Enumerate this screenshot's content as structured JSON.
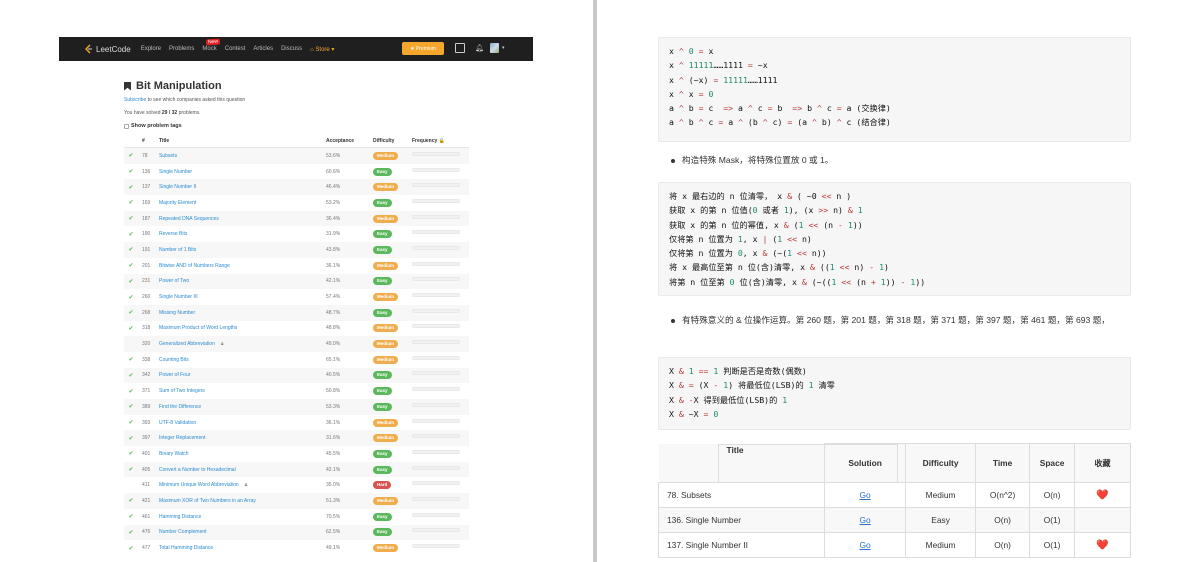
{
  "left": {
    "navbar": {
      "brand": "LeetCode",
      "items": [
        "Explore",
        "Problems",
        "Mock",
        "Contest",
        "Articles",
        "Discuss"
      ],
      "new_badge": "New",
      "store": "Store ▾",
      "premium": "★ Premium"
    },
    "page_title": "Bit Manipulation",
    "subscribe_link": "Subscribe",
    "subscribe_text": " to see which companies asked this question",
    "solved_prefix": "You have solved ",
    "solved_count": "29 / 32",
    "solved_suffix": " problems.",
    "show_tags": "Show problem tags",
    "columns": [
      "#",
      "Title",
      "Acceptance",
      "Difficulty",
      "Frequency 🔒"
    ],
    "rows": [
      {
        "solved": true,
        "num": "78",
        "title": "Subsets",
        "acc": "53.6%",
        "diff": "Medium",
        "locked": false
      },
      {
        "solved": true,
        "num": "136",
        "title": "Single Number",
        "acc": "60.6%",
        "diff": "Easy",
        "locked": false
      },
      {
        "solved": true,
        "num": "137",
        "title": "Single Number II",
        "acc": "46.4%",
        "diff": "Medium",
        "locked": false
      },
      {
        "solved": true,
        "num": "169",
        "title": "Majority Element",
        "acc": "53.2%",
        "diff": "Easy",
        "locked": false
      },
      {
        "solved": true,
        "num": "187",
        "title": "Repeated DNA Sequences",
        "acc": "36.4%",
        "diff": "Medium",
        "locked": false
      },
      {
        "solved": true,
        "num": "190",
        "title": "Reverse Bits",
        "acc": "31.9%",
        "diff": "Easy",
        "locked": false
      },
      {
        "solved": true,
        "num": "191",
        "title": "Number of 1 Bits",
        "acc": "43.8%",
        "diff": "Easy",
        "locked": false
      },
      {
        "solved": true,
        "num": "201",
        "title": "Bitwise AND of Numbers Range",
        "acc": "36.1%",
        "diff": "Medium",
        "locked": false
      },
      {
        "solved": true,
        "num": "231",
        "title": "Power of Two",
        "acc": "42.1%",
        "diff": "Easy",
        "locked": false
      },
      {
        "solved": true,
        "num": "260",
        "title": "Single Number III",
        "acc": "57.4%",
        "diff": "Medium",
        "locked": false
      },
      {
        "solved": true,
        "num": "268",
        "title": "Missing Number",
        "acc": "48.7%",
        "diff": "Easy",
        "locked": false
      },
      {
        "solved": true,
        "num": "318",
        "title": "Maximum Product of Word Lengths",
        "acc": "48.8%",
        "diff": "Medium",
        "locked": false
      },
      {
        "solved": false,
        "num": "320",
        "title": "Generalized Abbreviation",
        "acc": "49.0%",
        "diff": "Medium",
        "locked": true
      },
      {
        "solved": true,
        "num": "338",
        "title": "Counting Bits",
        "acc": "65.1%",
        "diff": "Medium",
        "locked": false
      },
      {
        "solved": true,
        "num": "342",
        "title": "Power of Four",
        "acc": "40.5%",
        "diff": "Easy",
        "locked": false
      },
      {
        "solved": true,
        "num": "371",
        "title": "Sum of Two Integers",
        "acc": "50.8%",
        "diff": "Easy",
        "locked": false
      },
      {
        "solved": true,
        "num": "389",
        "title": "Find the Difference",
        "acc": "53.3%",
        "diff": "Easy",
        "locked": false
      },
      {
        "solved": true,
        "num": "393",
        "title": "UTF-8 Validation",
        "acc": "36.1%",
        "diff": "Medium",
        "locked": false
      },
      {
        "solved": true,
        "num": "397",
        "title": "Integer Replacement",
        "acc": "31.6%",
        "diff": "Medium",
        "locked": false
      },
      {
        "solved": true,
        "num": "401",
        "title": "Binary Watch",
        "acc": "45.5%",
        "diff": "Easy",
        "locked": false
      },
      {
        "solved": true,
        "num": "405",
        "title": "Convert a Number to Hexadecimal",
        "acc": "42.1%",
        "diff": "Easy",
        "locked": false
      },
      {
        "solved": false,
        "num": "411",
        "title": "Minimum Unique Word Abbreviation",
        "acc": "35.0%",
        "diff": "Hard",
        "locked": true
      },
      {
        "solved": true,
        "num": "421",
        "title": "Maximum XOR of Two Numbers in an Array",
        "acc": "51.3%",
        "diff": "Medium",
        "locked": false
      },
      {
        "solved": true,
        "num": "461",
        "title": "Hamming Distance",
        "acc": "70.5%",
        "diff": "Easy",
        "locked": false
      },
      {
        "solved": true,
        "num": "476",
        "title": "Number Complement",
        "acc": "62.5%",
        "diff": "Easy",
        "locked": false
      },
      {
        "solved": true,
        "num": "477",
        "title": "Total Hamming Distance",
        "acc": "49.1%",
        "diff": "Medium",
        "locked": false
      }
    ]
  },
  "right": {
    "code1": [
      [
        [
          "t",
          "x "
        ],
        [
          "k",
          "^"
        ],
        [
          "t",
          " "
        ],
        [
          "n",
          "0"
        ],
        [
          "t",
          " "
        ],
        [
          "k",
          "="
        ],
        [
          "t",
          " x"
        ]
      ],
      [
        [
          "t",
          "x "
        ],
        [
          "k",
          "^"
        ],
        [
          "t",
          " "
        ],
        [
          "n",
          "11111"
        ],
        [
          "t",
          "……1111 "
        ],
        [
          "k",
          "="
        ],
        [
          "t",
          " ~x"
        ]
      ],
      [
        [
          "t",
          "x "
        ],
        [
          "k",
          "^"
        ],
        [
          "t",
          " (~x) "
        ],
        [
          "k",
          "="
        ],
        [
          "t",
          " "
        ],
        [
          "n",
          "11111"
        ],
        [
          "t",
          "……1111"
        ]
      ],
      [
        [
          "t",
          "x "
        ],
        [
          "k",
          "^"
        ],
        [
          "t",
          " x "
        ],
        [
          "k",
          "="
        ],
        [
          "t",
          " "
        ],
        [
          "n",
          "0"
        ]
      ],
      [
        [
          "t",
          "a "
        ],
        [
          "k",
          "^"
        ],
        [
          "t",
          " b "
        ],
        [
          "k",
          "="
        ],
        [
          "t",
          " c  "
        ],
        [
          "k",
          "=>"
        ],
        [
          "t",
          " a "
        ],
        [
          "k",
          "^"
        ],
        [
          "t",
          " c "
        ],
        [
          "k",
          "="
        ],
        [
          "t",
          " b  "
        ],
        [
          "k",
          "=>"
        ],
        [
          "t",
          " b "
        ],
        [
          "k",
          "^"
        ],
        [
          "t",
          " c "
        ],
        [
          "k",
          "="
        ],
        [
          "t",
          " a (交换律)"
        ]
      ],
      [
        [
          "t",
          "a "
        ],
        [
          "k",
          "^"
        ],
        [
          "t",
          " b "
        ],
        [
          "k",
          "^"
        ],
        [
          "t",
          " c "
        ],
        [
          "k",
          "="
        ],
        [
          "t",
          " a "
        ],
        [
          "k",
          "^"
        ],
        [
          "t",
          " (b "
        ],
        [
          "k",
          "^"
        ],
        [
          "t",
          " c) "
        ],
        [
          "k",
          "="
        ],
        [
          "t",
          " (a "
        ],
        [
          "k",
          "^"
        ],
        [
          "t",
          " b) "
        ],
        [
          "k",
          "^"
        ],
        [
          "t",
          " c (结合律)"
        ]
      ]
    ],
    "bullet1": "构造特殊 Mask，将特殊位置放 0 或 1。",
    "code2": [
      [
        [
          "t",
          "将 x 最右边的 n 位清零， x "
        ],
        [
          "k",
          "&"
        ],
        [
          "t",
          " ( ~0 "
        ],
        [
          "k",
          "<<"
        ],
        [
          "t",
          " n )"
        ]
      ],
      [
        [
          "t",
          "获取 x 的第 n 位值("
        ],
        [
          "n",
          "0"
        ],
        [
          "t",
          " 或者 "
        ],
        [
          "n",
          "1"
        ],
        [
          "t",
          "), (x "
        ],
        [
          "k",
          ">>"
        ],
        [
          "t",
          " n) "
        ],
        [
          "k",
          "&"
        ],
        [
          "t",
          " "
        ],
        [
          "n",
          "1"
        ]
      ],
      [
        [
          "t",
          "获取 x 的第 n 位的幂值, x "
        ],
        [
          "k",
          "&"
        ],
        [
          "t",
          " ("
        ],
        [
          "n",
          "1"
        ],
        [
          "t",
          " "
        ],
        [
          "k",
          "<<"
        ],
        [
          "t",
          " (n "
        ],
        [
          "k",
          "-"
        ],
        [
          "t",
          " "
        ],
        [
          "n",
          "1"
        ],
        [
          "t",
          "))"
        ]
      ],
      [
        [
          "t",
          "仅将第 n 位置为 "
        ],
        [
          "n",
          "1"
        ],
        [
          "t",
          ", x "
        ],
        [
          "k",
          "|"
        ],
        [
          "t",
          " ("
        ],
        [
          "n",
          "1"
        ],
        [
          "t",
          " "
        ],
        [
          "k",
          "<<"
        ],
        [
          "t",
          " n)"
        ]
      ],
      [
        [
          "t",
          "仅将第 n 位置为 "
        ],
        [
          "n",
          "0"
        ],
        [
          "t",
          ", x "
        ],
        [
          "k",
          "&"
        ],
        [
          "t",
          " (~("
        ],
        [
          "n",
          "1"
        ],
        [
          "t",
          " "
        ],
        [
          "k",
          "<<"
        ],
        [
          "t",
          " n))"
        ]
      ],
      [
        [
          "t",
          "将 x 最高位至第 n 位(含)清零, x "
        ],
        [
          "k",
          "&"
        ],
        [
          "t",
          " (("
        ],
        [
          "n",
          "1"
        ],
        [
          "t",
          " "
        ],
        [
          "k",
          "<<"
        ],
        [
          "t",
          " n) "
        ],
        [
          "k",
          "-"
        ],
        [
          "t",
          " "
        ],
        [
          "n",
          "1"
        ],
        [
          "t",
          ")"
        ]
      ],
      [
        [
          "t",
          "将第 n 位至第 "
        ],
        [
          "n",
          "0"
        ],
        [
          "t",
          " 位(含)清零, x "
        ],
        [
          "k",
          "&"
        ],
        [
          "t",
          " (~(("
        ],
        [
          "n",
          "1"
        ],
        [
          "t",
          " "
        ],
        [
          "k",
          "<<"
        ],
        [
          "t",
          " (n "
        ],
        [
          "k",
          "+"
        ],
        [
          "t",
          " "
        ],
        [
          "n",
          "1"
        ],
        [
          "t",
          ")) "
        ],
        [
          "k",
          "-"
        ],
        [
          "t",
          " "
        ],
        [
          "n",
          "1"
        ],
        [
          "t",
          "))"
        ]
      ]
    ],
    "bullet2": "有特殊意义的 & 位操作运算。第 260 题，第 201 题，第 318 题，第 371 题，第 397 题，第 461 题，第 693 题，",
    "code3": [
      [
        [
          "t",
          "X "
        ],
        [
          "k",
          "&"
        ],
        [
          "t",
          " "
        ],
        [
          "n",
          "1"
        ],
        [
          "t",
          " "
        ],
        [
          "k",
          "=="
        ],
        [
          "t",
          " "
        ],
        [
          "n",
          "1"
        ],
        [
          "t",
          " 判断是否是奇数(偶数)"
        ]
      ],
      [
        [
          "t",
          "X "
        ],
        [
          "k",
          "&"
        ],
        [
          "t",
          " "
        ],
        [
          "k",
          "="
        ],
        [
          "t",
          " (X "
        ],
        [
          "k",
          "-"
        ],
        [
          "t",
          " "
        ],
        [
          "n",
          "1"
        ],
        [
          "t",
          ") 将最低位(LSB)的 "
        ],
        [
          "n",
          "1"
        ],
        [
          "t",
          " 清零"
        ]
      ],
      [
        [
          "t",
          "X "
        ],
        [
          "k",
          "&"
        ],
        [
          "t",
          " "
        ],
        [
          "k",
          "-"
        ],
        [
          "t",
          "X 得到最低位(LSB)的 "
        ],
        [
          "n",
          "1"
        ]
      ],
      [
        [
          "t",
          "X "
        ],
        [
          "k",
          "&"
        ],
        [
          "t",
          " ~X "
        ],
        [
          "k",
          "="
        ],
        [
          "t",
          " "
        ],
        [
          "n",
          "0"
        ]
      ]
    ],
    "table": {
      "headers": [
        "Title",
        "Solution",
        "Difficulty",
        "Time",
        "Space",
        "收藏"
      ],
      "rows": [
        {
          "title": "78. Subsets",
          "solution": "Go",
          "difficulty": "Medium",
          "time": "O(n^2)",
          "space": "O(n)",
          "fav": true
        },
        {
          "title": "136. Single Number",
          "solution": "Go",
          "difficulty": "Easy",
          "time": "O(n)",
          "space": "O(1)",
          "fav": false
        },
        {
          "title": "137. Single Number II",
          "solution": "Go",
          "difficulty": "Medium",
          "time": "O(n)",
          "space": "O(1)",
          "fav": true
        }
      ],
      "fav_glyph": "❤️"
    }
  }
}
